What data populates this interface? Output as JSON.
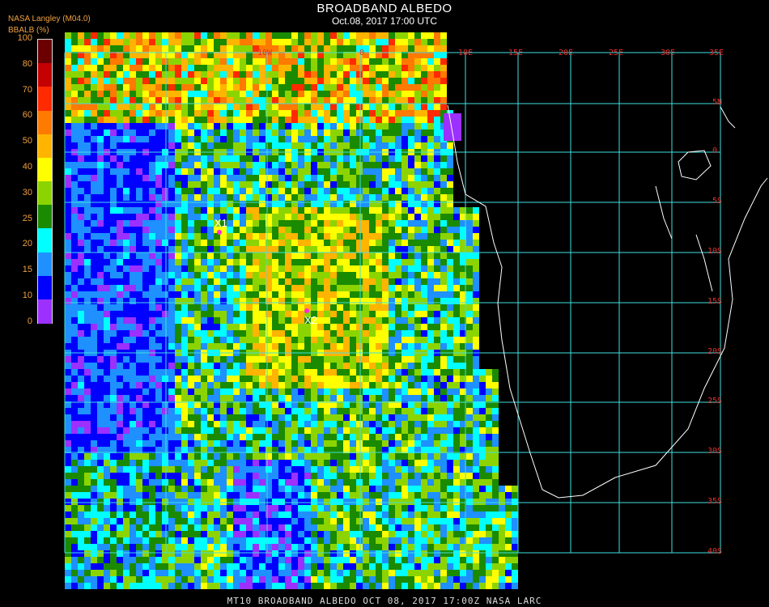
{
  "header": {
    "title": "BROADBAND ALBEDO",
    "subtitle": "Oct.08, 2017 17:00 UTC"
  },
  "colorbar": {
    "source": "NASA Langley (M04.0)",
    "label": "BBALB (%)",
    "ticks": [
      "100",
      "80",
      "70",
      "60",
      "50",
      "40",
      "30",
      "25",
      "20",
      "15",
      "10",
      "0"
    ],
    "colors": [
      "#6b0000",
      "#c40000",
      "#ff2a00",
      "#ff7a00",
      "#ffb400",
      "#ffff00",
      "#8cd400",
      "#1a8a00",
      "#00ffff",
      "#1e90ff",
      "#0000ff",
      "#9b30ff"
    ]
  },
  "gridlines": {
    "lon_labels": [
      "10W",
      "0",
      "10E",
      "15E",
      "20E",
      "25E",
      "30E",
      "35E"
    ],
    "lat_labels": [
      "5N",
      "0",
      "5S",
      "10S",
      "15S",
      "20S",
      "25S",
      "30S",
      "35S",
      "40S"
    ],
    "line_color": "#40e0e0",
    "label_color": "#e23030"
  },
  "markers": [
    {
      "label": "X1"
    },
    {
      "label": "X2"
    }
  ],
  "footer": "MT10  BROADBAND ALBEDO   OCT 08, 2017 17:00Z   NASA LARC"
}
